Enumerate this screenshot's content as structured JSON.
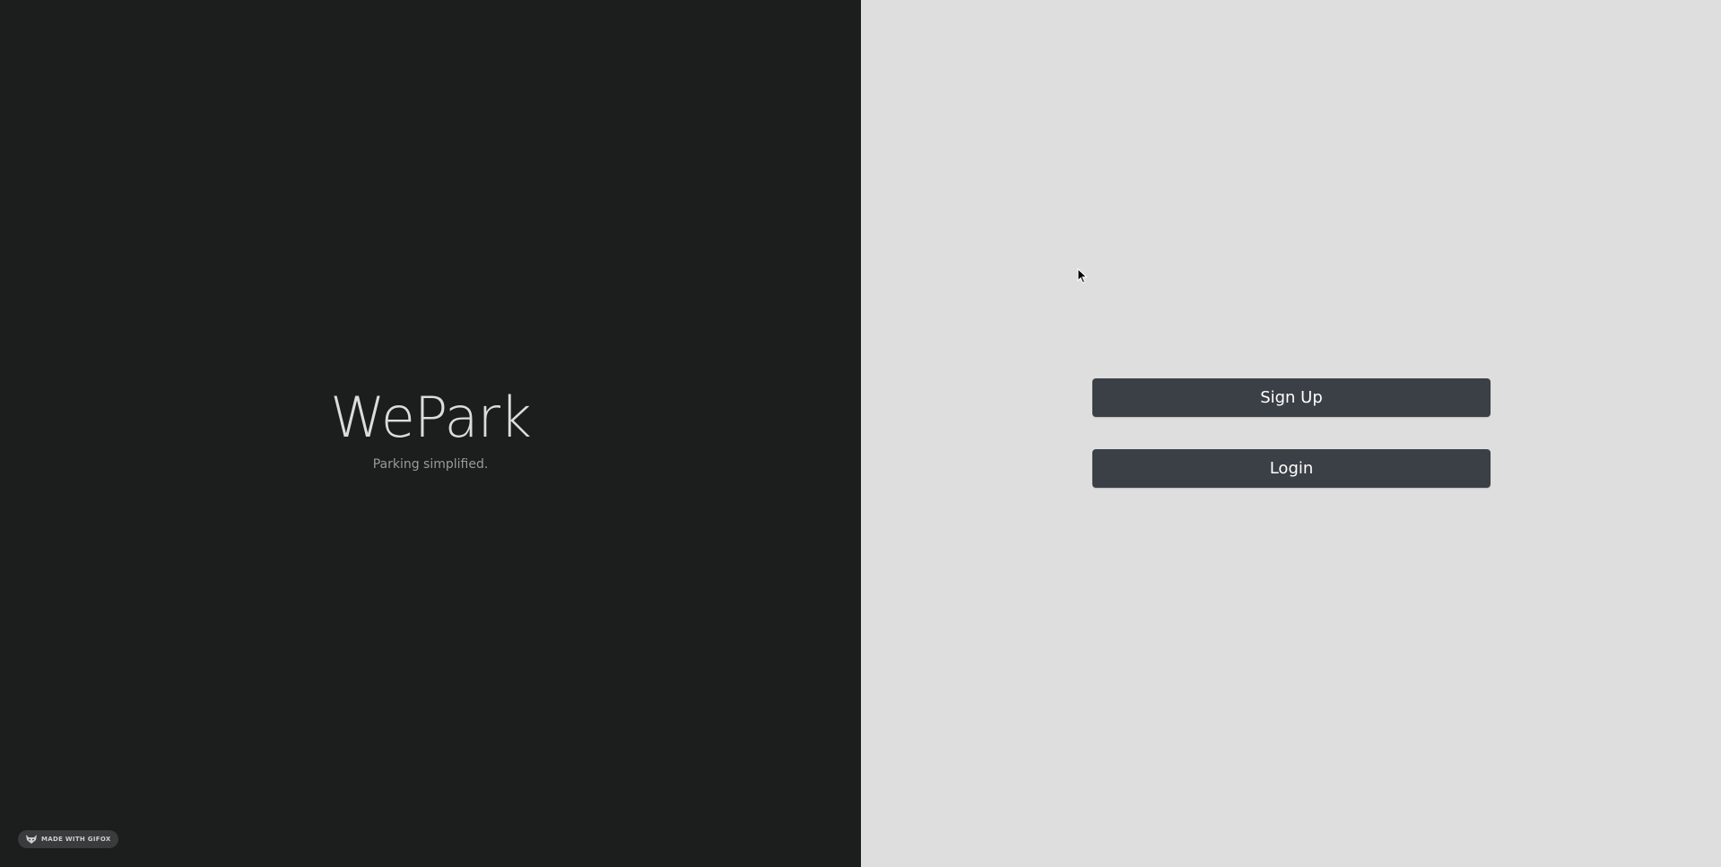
{
  "brand": {
    "title": "WePark",
    "tagline": "Parking simplified."
  },
  "actions": {
    "signup_label": "Sign Up",
    "login_label": "Login"
  },
  "badge": {
    "label": "MADE WITH GIFOX",
    "icon": "fox-icon"
  },
  "colors": {
    "left_background": "#1c1d1d",
    "right_background": "#dedede",
    "button_background": "#3b3f46",
    "button_text": "#ffffff"
  }
}
